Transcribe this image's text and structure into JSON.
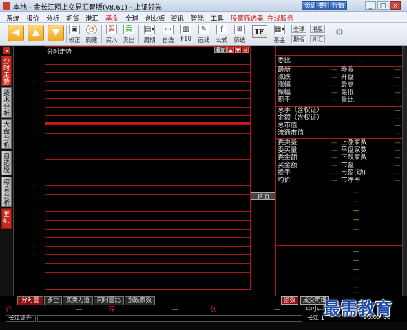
{
  "window": {
    "title": "本地 - 金长江网上交易汇智版(v8.61) - 上证领先",
    "header_buttons": [
      "资讯",
      "委托",
      "行情"
    ],
    "controls": [
      "_",
      "□",
      "×"
    ]
  },
  "menu": {
    "items": [
      {
        "label": "系统",
        "red": false
      },
      {
        "label": "报价",
        "red": false
      },
      {
        "label": "分析",
        "red": false
      },
      {
        "label": "期货",
        "red": false
      },
      {
        "label": "港汇",
        "red": false
      },
      {
        "label": "基金",
        "red": true
      },
      {
        "label": "全球",
        "red": false
      },
      {
        "label": "创业板",
        "red": false
      },
      {
        "label": "资讯",
        "red": false
      },
      {
        "label": "智能",
        "red": false
      },
      {
        "label": "工具",
        "red": false
      },
      {
        "label": "股票筛选器",
        "red": true
      },
      {
        "label": "在线服务",
        "red": true
      }
    ]
  },
  "toolbar": {
    "tools": [
      {
        "label": "修正",
        "icon": "dialog-icon"
      },
      {
        "label": "刷建",
        "icon": "clock-icon"
      },
      {
        "label": "买入",
        "icon": "buy-icon"
      },
      {
        "label": "卖出",
        "icon": "sell-icon"
      },
      {
        "label": "周期",
        "icon": "period-icon"
      },
      {
        "label": "自选",
        "icon": "window-icon"
      },
      {
        "label": "F10",
        "icon": "f10-icon"
      },
      {
        "label": "画线",
        "icon": "pen-icon"
      },
      {
        "label": "公式",
        "icon": "formula-icon"
      },
      {
        "label": "筛选",
        "icon": "filter-icon"
      }
    ],
    "if_label": "IF",
    "fund_label": "基金",
    "mini_buttons": [
      "全球",
      "港股",
      "期指",
      "外汇"
    ]
  },
  "sidebar": {
    "tabs": [
      "分时走势",
      "技术分析",
      "大盘分析",
      "自选股",
      "综合分析",
      "更多..."
    ]
  },
  "chart": {
    "title": "分时走势",
    "controls": [
      "叠加",
      "▲",
      "▼",
      "×"
    ],
    "zone_label": "区间"
  },
  "quote": {
    "header": "委比",
    "header_value": "—",
    "rows_a": [
      {
        "label": "最新",
        "value": "—",
        "label2": "昨收",
        "value2": "—"
      },
      {
        "label": "涨跌",
        "value": "—",
        "label2": "开盘",
        "value2": "—"
      },
      {
        "label": "涨幅",
        "value": "—",
        "label2": "最高",
        "value2": "—"
      },
      {
        "label": "振幅",
        "value": "—",
        "label2": "最低",
        "value2": "—"
      },
      {
        "label": "现手",
        "value": "—",
        "label2": "量比",
        "value2": "—"
      }
    ],
    "rows_b": [
      {
        "label": "总手（含权证）",
        "value": "—"
      },
      {
        "label": "金额（含权证）",
        "value": "—"
      },
      {
        "label": "总市值",
        "value": "—"
      },
      {
        "label": "流通市值",
        "value": "—"
      }
    ],
    "rows_c": [
      {
        "label": "委卖量",
        "value": "—",
        "label2": "上涨家数",
        "value2": "—"
      },
      {
        "label": "委买量",
        "value": "—",
        "label2": "平盘家数",
        "value2": "—"
      },
      {
        "label": "委金额",
        "value": "—",
        "label2": "下跌家数",
        "value2": "—"
      },
      {
        "label": "买金额",
        "value": "—",
        "label2": "市盈",
        "value2": "—"
      },
      {
        "label": "换手",
        "value": "—",
        "label2": "市盈(动)",
        "value2": "—"
      },
      {
        "label": "均价",
        "value": "—",
        "label2": "市净率",
        "value2": "—"
      }
    ],
    "tick_values": [
      "—",
      "—",
      "—",
      "—",
      "—",
      "—",
      "—",
      "—",
      "—",
      "—",
      "—"
    ]
  },
  "bottom_tabs": [
    "分时量",
    "多空",
    "买卖力道",
    "同时量比",
    "涨跌家数"
  ],
  "right_tabs": [
    "指数",
    "成交明细"
  ],
  "index_strip": [
    {
      "label": "沪",
      "value": "—"
    },
    {
      "label": "深",
      "value": "—"
    },
    {
      "label": "创",
      "value": "—"
    },
    {
      "label": "中小",
      "value": "—"
    }
  ],
  "status": {
    "broker": "长江证券",
    "broker_right": "长江 1",
    "clock": "16:05:08"
  },
  "watermark": "最需教育",
  "colors": {
    "grid_red": "#b01818",
    "menu_red": "#d41414",
    "active_tab": "#8b0f0f",
    "watermark_blue": "#1f4ca8"
  }
}
